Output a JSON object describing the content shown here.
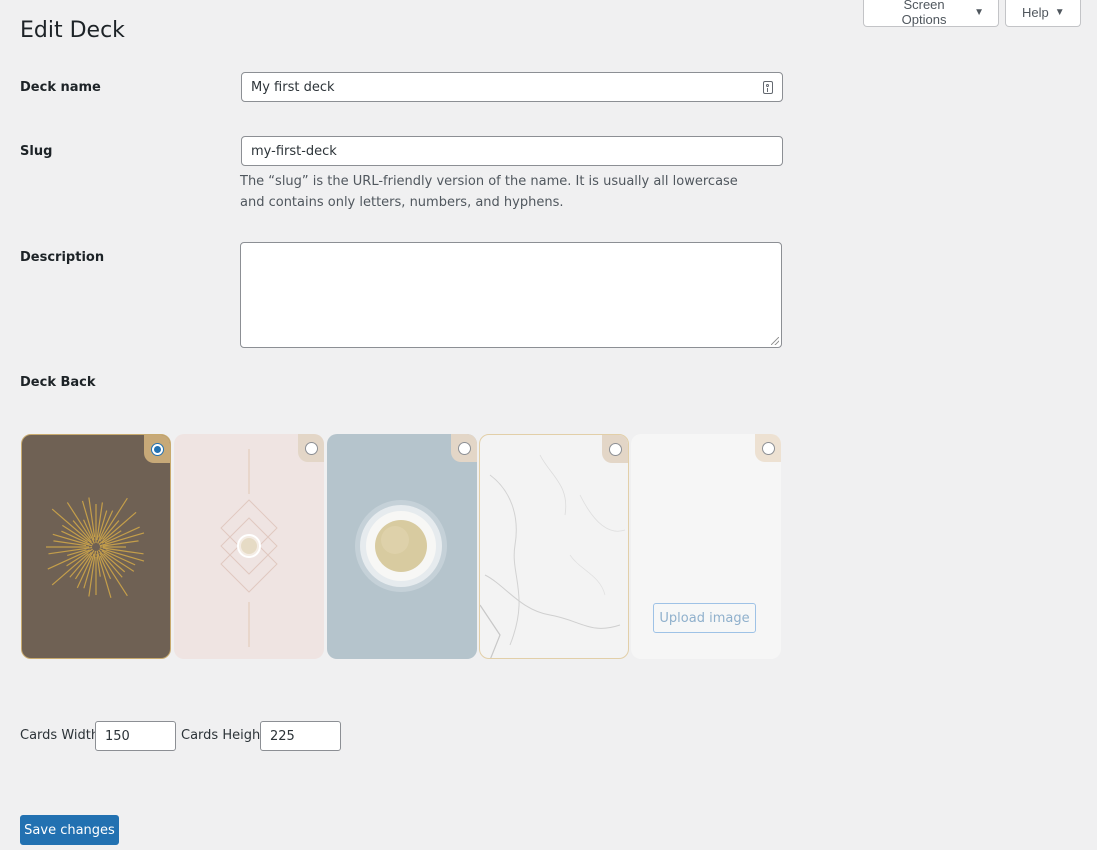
{
  "header": {
    "screen_options_label": "Screen Options",
    "help_label": "Help",
    "title": "Edit Deck"
  },
  "form": {
    "deck_name": {
      "label": "Deck name",
      "value": "My first deck"
    },
    "slug": {
      "label": "Slug",
      "value": "my-first-deck",
      "help": "The “slug” is the URL-friendly version of the name. It is usually all lowercase and contains only letters, numbers, and hyphens."
    },
    "description": {
      "label": "Description",
      "value": ""
    },
    "deck_back": {
      "label": "Deck Back",
      "selected_index": 0,
      "upload_label": "Upload image"
    },
    "cards_width": {
      "label": "Cards Width",
      "value": "150"
    },
    "cards_height": {
      "label": "Cards Height",
      "value": "225"
    },
    "save_label": "Save changes"
  },
  "colors": {
    "primary": "#2271b1",
    "background": "#f0f0f1"
  }
}
